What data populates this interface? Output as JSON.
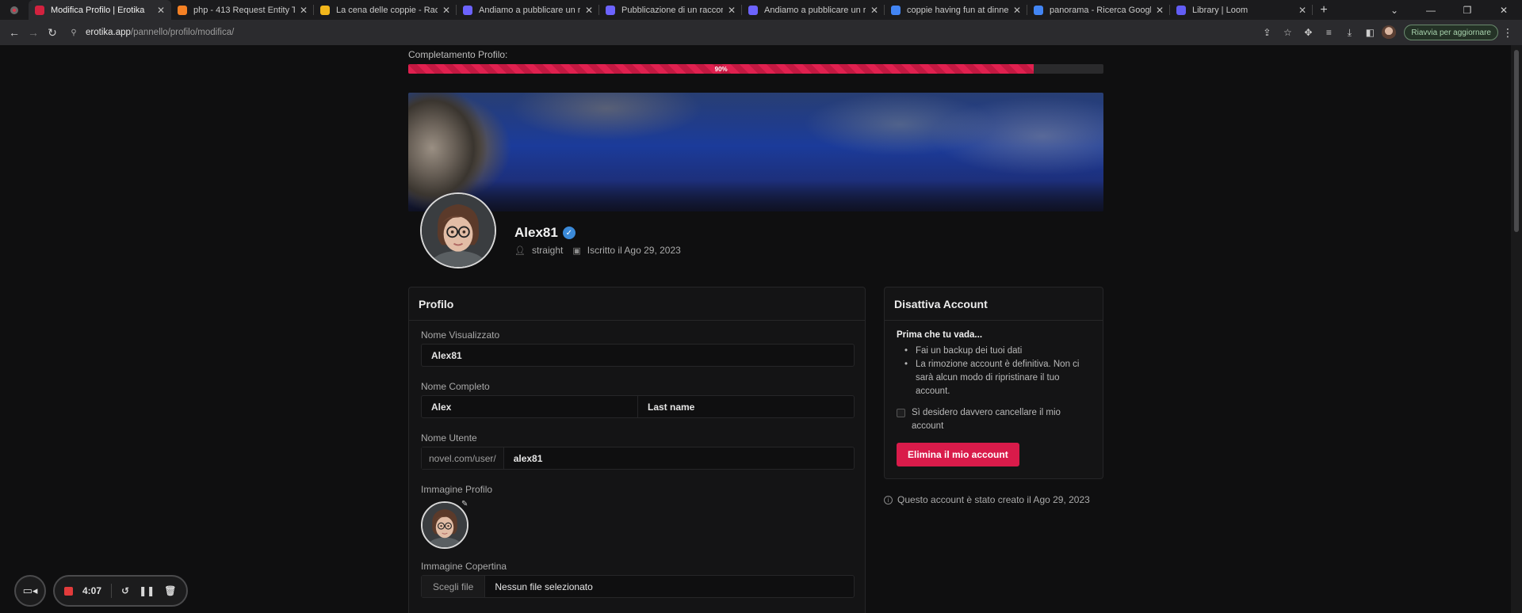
{
  "browser": {
    "tabs": [
      {
        "title": "Modifica Profilo | Erotika",
        "favicon_color": "#d3223f",
        "active": true
      },
      {
        "title": "php - 413 Request Entity Too Lar",
        "favicon_color": "#f48024",
        "active": false
      },
      {
        "title": "La cena delle coppie - Racconti e",
        "favicon_color": "#f3b71b",
        "active": false
      },
      {
        "title": "Andiamo a pubblicare un raccont",
        "favicon_color": "#6c63ff",
        "active": false
      },
      {
        "title": "Pubblicazione di un racconto su",
        "favicon_color": "#6c63ff",
        "active": false
      },
      {
        "title": "Andiamo a pubblicare un raccont",
        "favicon_color": "#6c63ff",
        "active": false
      },
      {
        "title": "coppie having fun at dinner - Ric",
        "favicon_color": "#4285f4",
        "active": false
      },
      {
        "title": "panorama - Ricerca Google",
        "favicon_color": "#4285f4",
        "active": false
      },
      {
        "title": "Library | Loom",
        "favicon_color": "#625df5",
        "active": false
      }
    ],
    "url_host": "erotika.app",
    "url_path": "/pannello/profilo/modifica/",
    "update_label": "Riavvia per aggiornare"
  },
  "progress": {
    "label": "Completamento Profilo:",
    "percent_text": "90%",
    "percent": 90
  },
  "profile": {
    "username": "Alex81",
    "orientation": "straight",
    "joined": "Iscritto il Ago 29, 2023"
  },
  "profile_card": {
    "title": "Profilo",
    "display_name_label": "Nome Visualizzato",
    "display_name_value": "Alex81",
    "full_name_label": "Nome Completo",
    "first_name_value": "Alex",
    "last_name_placeholder": "Last name",
    "username_label": "Nome Utente",
    "username_prefix": "novel.com/user/",
    "username_value": "alex81",
    "profile_image_label": "Immagine Profilo",
    "cover_image_label": "Immagine Copertina",
    "choose_file_label": "Scegli file",
    "no_file_label": "Nessun file selezionato"
  },
  "deactivate_card": {
    "title": "Disattiva Account",
    "subtitle": "Prima che tu vada...",
    "items": [
      "Fai un backup dei tuoi dati",
      "La rimozione account è definitiva. Non ci sarà alcun modo di ripristinare il tuo account."
    ],
    "checkbox_label": "Sì desidero davvero cancellare il mio account",
    "button_label": "Elimina il mio account",
    "created_note": "Questo account è stato creato il Ago 29, 2023"
  },
  "recorder": {
    "time": "4:07"
  },
  "colors": {
    "accent": "#d91b4a",
    "verified": "#3b8ad9"
  }
}
